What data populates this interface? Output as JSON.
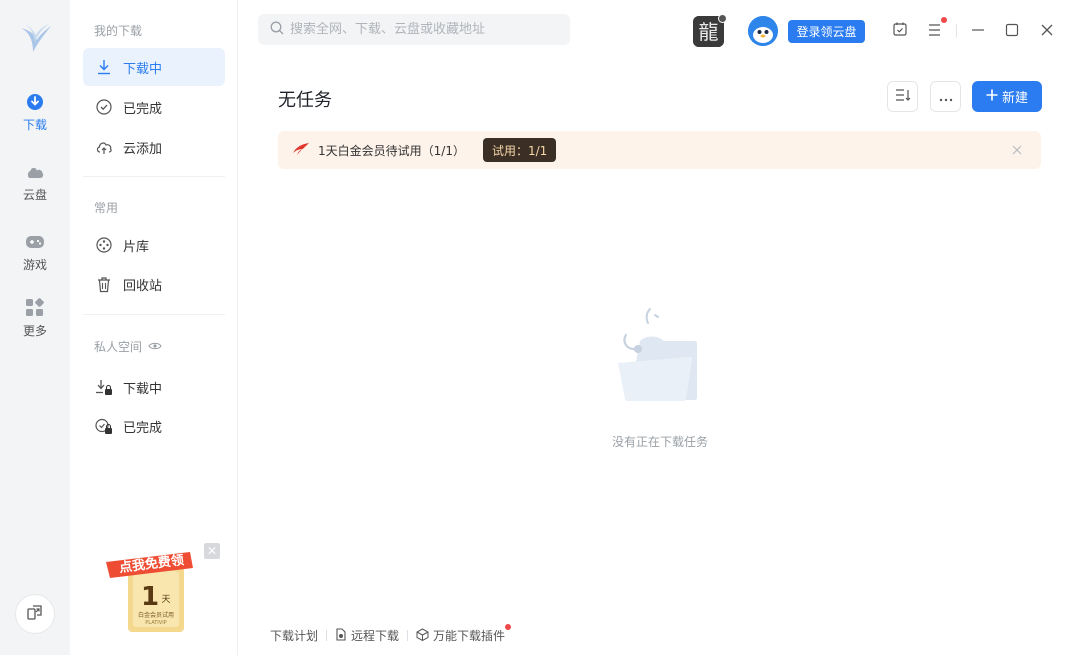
{
  "rail": {
    "items": [
      {
        "label": "下载",
        "icon": "download-icon"
      },
      {
        "label": "云盘",
        "icon": "cloud-icon"
      },
      {
        "label": "游戏",
        "icon": "gamepad-icon"
      },
      {
        "label": "更多",
        "icon": "grid-icon"
      }
    ],
    "active": "下载"
  },
  "sidebar": {
    "section_downloads": "我的下载",
    "downloading": "下载中",
    "completed": "已完成",
    "cloud_add": "云添加",
    "section_common": "常用",
    "library": "片库",
    "recycle": "回收站",
    "section_private": "私人空间",
    "private_downloading": "下载中",
    "private_completed": "已完成",
    "promo": {
      "line1": "点我免费领",
      "number": "1",
      "unit": "天",
      "sub": "白金会员试用",
      "brand": "PLATIVIP"
    }
  },
  "search": {
    "placeholder": "搜索全网、下载、云盘或收藏地址"
  },
  "topbar": {
    "game_avatar_text": "龍",
    "login_button": "登录领云盘"
  },
  "main": {
    "title": "无任务",
    "new_button": "新建",
    "banner": {
      "text": "1天白金会员待试用（1/1）",
      "badge": "试用：1/1"
    },
    "empty_text": "没有正在下载任务"
  },
  "footer": {
    "plan": "下载计划",
    "remote": "远程下载",
    "plugin": "万能下载插件"
  },
  "colors": {
    "accent": "#2a7cf0",
    "banner_bg": "#fdf3ea",
    "badge_bg": "#3a2e25",
    "notify": "#f04848"
  }
}
